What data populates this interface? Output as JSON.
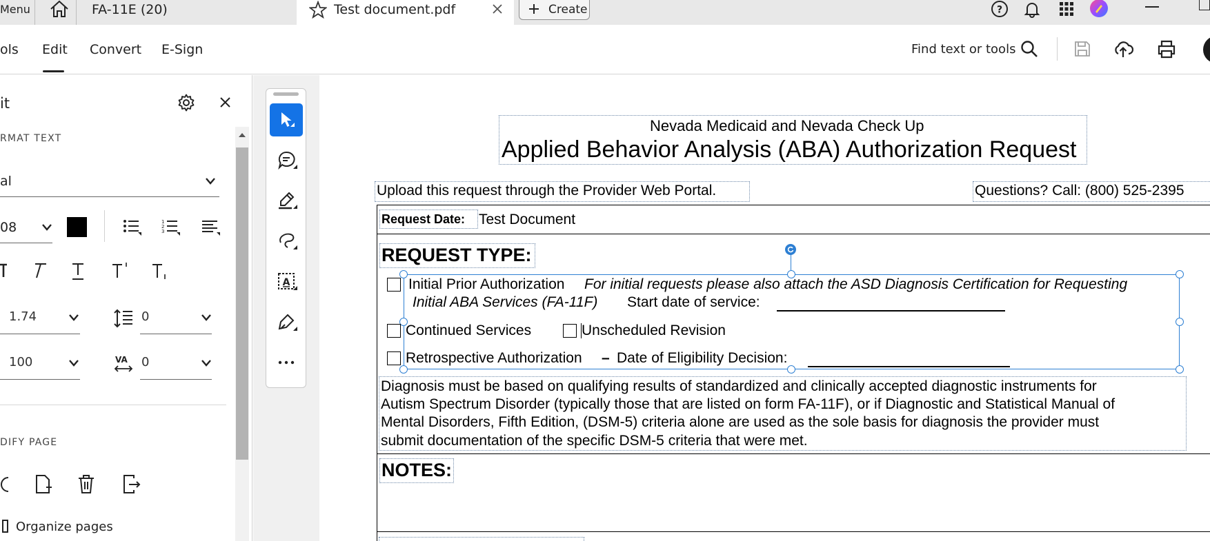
{
  "tabbar": {
    "menu_label": "Menu",
    "tab1_label": "FA-11E (20)",
    "tab2_label": "Test document.pdf",
    "create_label": "Create"
  },
  "toolbar": {
    "nav_items": [
      "ols",
      "Edit",
      "Convert",
      "E-Sign"
    ],
    "active_item": "Edit",
    "find_label": "Find text or tools"
  },
  "panel": {
    "title": "it",
    "format_text_label": "RMAT TEXT",
    "font_value": "al",
    "font_size_value": "08",
    "text_color": "#000000",
    "line_spacing_value": "1.74",
    "paragraph_spacing_value": "0",
    "horizontal_scale_value": "100",
    "char_spacing_value": "0",
    "modify_page_label": "DIFY PAGE",
    "organize_pages_label": "Organize pages"
  },
  "document": {
    "header_line1": "Nevada Medicaid and Nevada Check Up",
    "header_line2": "Applied Behavior Analysis (ABA) Authorization Request",
    "upload_note": "Upload this request through the Provider Web Portal.",
    "questions_note": "Questions?  Call: (800) 525-2395",
    "request_date_label": "Request Date:",
    "request_date_value": "Test Document",
    "request_type_label": "REQUEST TYPE:",
    "initial_prior_auth": "Initial Prior Authorization",
    "initial_note_line1": "For initial requests please also attach the ASD Diagnosis Certification for Requesting",
    "initial_note_line2": "Initial ABA Services (FA-11F)",
    "start_date_label": "Start date of service:",
    "continued_services": "Continued Services",
    "unscheduled_revision": "Unscheduled Revision",
    "retro_auth": "Retrospective Authorization",
    "retro_dash": "–",
    "eligibility_label": "Date of Eligibility Decision:",
    "diagnosis_lines": [
      "Diagnosis must be based on qualifying results of standardized and clinically accepted diagnostic instruments for",
      "Autism Spectrum Disorder (typically those that are listed on form FA-11F), or if Diagnostic and Statistical Manual of",
      "Mental Disorders, Fifth Edition, (DSM-5) criteria alone are used as the sole basis for diagnosis the provider must",
      "submit documentation of the specific DSM-5 criteria that were met."
    ],
    "notes_label": "NOTES:"
  },
  "colors": {
    "accent": "#1473e6",
    "selection": "#2d7fd3"
  },
  "icons": [
    "home-icon",
    "star-icon",
    "close-icon",
    "plus-icon",
    "help-icon",
    "bell-icon",
    "apps-grid-icon",
    "search-icon",
    "save-icon",
    "cloud-upload-icon",
    "print-icon",
    "gear-icon",
    "chevron-down-icon",
    "bullet-list-icon",
    "numbered-list-icon",
    "align-left-icon",
    "select-arrow-icon",
    "comment-icon",
    "highlighter-icon",
    "lasso-icon",
    "text-box-icon",
    "sign-pen-icon",
    "more-icon",
    "rotate-icon",
    "insert-page-icon",
    "trash-icon",
    "extract-page-icon"
  ]
}
